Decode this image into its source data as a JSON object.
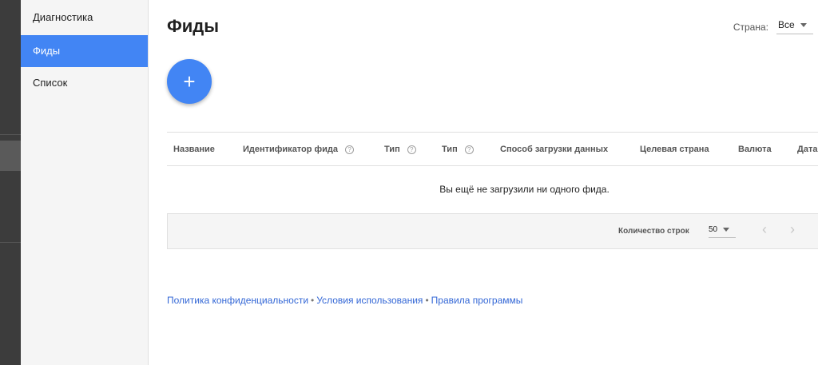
{
  "sidebar": {
    "items": [
      {
        "label": "Диагностика"
      },
      {
        "label": "Фиды"
      },
      {
        "label": "Список"
      }
    ]
  },
  "page": {
    "title": "Фиды",
    "country_label": "Страна:",
    "country_value": "Все",
    "add_button": "+"
  },
  "table": {
    "columns": [
      "Название",
      "Идентификатор фида",
      "Тип",
      "Тип",
      "Способ загрузки данных",
      "Целевая страна",
      "Валюта",
      "Дата"
    ],
    "help_glyph": "?",
    "empty_message": "Вы ещё не загрузили ни одного фида.",
    "rows_label": "Количество строк",
    "rows_value": "50",
    "prev": "‹",
    "next": "›"
  },
  "footer": {
    "links": [
      "Политика конфиденциальности",
      "Условия использования",
      "Правила программы"
    ],
    "separator": "•"
  }
}
